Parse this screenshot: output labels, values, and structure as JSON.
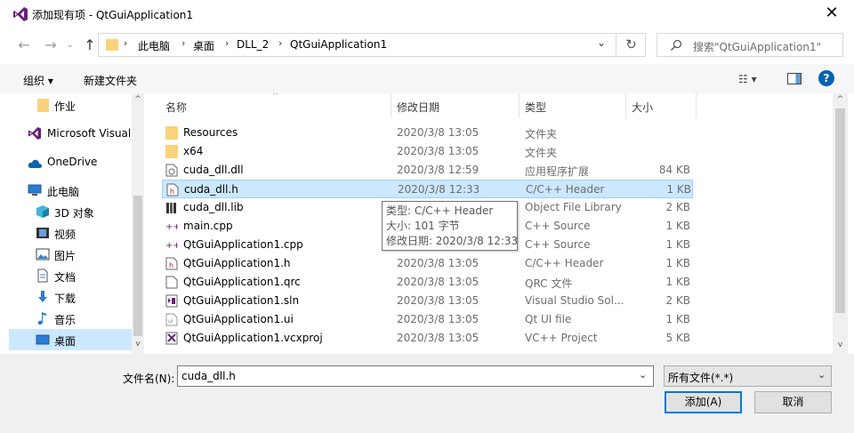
{
  "window": {
    "title": "添加现有项 - QtGuiApplication1",
    "close": "✕"
  },
  "nav": {
    "back": "←",
    "forward": "→",
    "up": "↑"
  },
  "address": {
    "segments": [
      "此电脑",
      "桌面",
      "DLL_2",
      "QtGuiApplication1"
    ],
    "separator": "›",
    "dropdown": "⌄",
    "refresh": "↻"
  },
  "search": {
    "placeholder": "搜索\"QtGuiApplication1\""
  },
  "toolbar": {
    "organize": "组织 ▾",
    "new_folder": "新建文件夹",
    "view": "☷ ▾",
    "help": "?"
  },
  "sidebar": {
    "items": [
      {
        "label": "作业",
        "icon": "folder-icon"
      },
      {
        "label": "Microsoft Visual",
        "icon": "visual-studio-icon"
      },
      {
        "label": "OneDrive",
        "icon": "cloud-icon"
      },
      {
        "label": "此电脑",
        "icon": "computer-icon"
      },
      {
        "label": "3D 对象",
        "icon": "cube-icon"
      },
      {
        "label": "视频",
        "icon": "video-icon"
      },
      {
        "label": "图片",
        "icon": "picture-icon"
      },
      {
        "label": "文档",
        "icon": "document-icon"
      },
      {
        "label": "下载",
        "icon": "download-icon"
      },
      {
        "label": "音乐",
        "icon": "music-icon"
      },
      {
        "label": "桌面",
        "icon": "desktop-icon"
      }
    ]
  },
  "columns": {
    "name": "名称",
    "date": "修改日期",
    "type": "类型",
    "size": "大小"
  },
  "files": [
    {
      "name": "Resources",
      "date": "2020/3/8 13:05",
      "type": "文件夹",
      "size": "",
      "icon": "folder-icon"
    },
    {
      "name": "x64",
      "date": "2020/3/8 13:05",
      "type": "文件夹",
      "size": "",
      "icon": "folder-icon"
    },
    {
      "name": "cuda_dll.dll",
      "date": "2020/3/8 12:59",
      "type": "应用程序扩展",
      "size": "84 KB",
      "icon": "dll-file-icon"
    },
    {
      "name": "cuda_dll.h",
      "date": "2020/3/8 12:33",
      "type": "C/C++ Header",
      "size": "1 KB",
      "icon": "header-file-icon"
    },
    {
      "name": "cuda_dll.lib",
      "date": "",
      "type": "Object File Library",
      "size": "2 KB",
      "icon": "lib-file-icon"
    },
    {
      "name": "main.cpp",
      "date": "",
      "type": "C++ Source",
      "size": "1 KB",
      "icon": "cpp-file-icon"
    },
    {
      "name": "QtGuiApplication1.cpp",
      "date": "",
      "type": "C++ Source",
      "size": "1 KB",
      "icon": "cpp-file-icon"
    },
    {
      "name": "QtGuiApplication1.h",
      "date": "2020/3/8 13:05",
      "type": "C/C++ Header",
      "size": "1 KB",
      "icon": "header-file-icon"
    },
    {
      "name": "QtGuiApplication1.qrc",
      "date": "2020/3/8 13:05",
      "type": "QRC 文件",
      "size": "1 KB",
      "icon": "blank-file-icon"
    },
    {
      "name": "QtGuiApplication1.sln",
      "date": "2020/3/8 13:05",
      "type": "Visual Studio Sol...",
      "size": "2 KB",
      "icon": "sln-file-icon"
    },
    {
      "name": "QtGuiApplication1.ui",
      "date": "2020/3/8 13:05",
      "type": "Qt UI file",
      "size": "1 KB",
      "icon": "ui-file-icon"
    },
    {
      "name": "QtGuiApplication1.vcxproj",
      "date": "2020/3/8 13:05",
      "type": "VC++ Project",
      "size": "5 KB",
      "icon": "vcxproj-file-icon"
    }
  ],
  "tooltip": {
    "line1": "类型: C/C++ Header",
    "line2": "大小: 101 字节",
    "line3": "修改日期: 2020/3/8 12:33"
  },
  "footer": {
    "filename_label": "文件名(N):",
    "filename_value": "cuda_dll.h",
    "filter_value": "所有文件(*.*)",
    "add_button": "添加(A)",
    "cancel_button": "取消"
  }
}
